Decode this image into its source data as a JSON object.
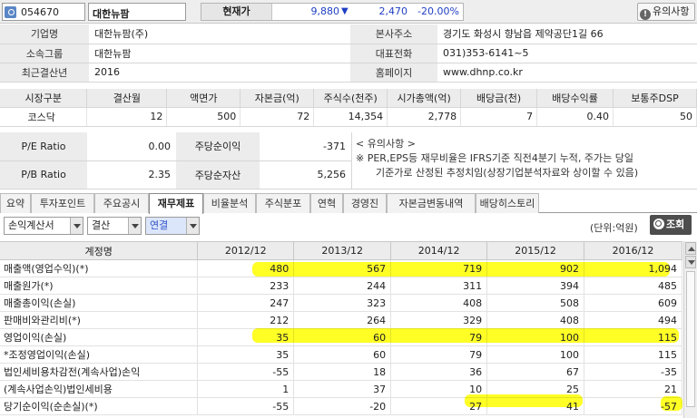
{
  "top": {
    "code": "054670",
    "name": "대한뉴팜",
    "price_label": "현재가",
    "price": "9,880",
    "change": "2,470",
    "change_pct": "-20.00%",
    "notice_label": "유의사항",
    "change_color": "#1f3fc4"
  },
  "info": {
    "rows": [
      {
        "h1": "기업명",
        "v1": "대한뉴팜(주)",
        "h2": "본사주소",
        "v2": "경기도 화성시 향남읍 제약공단1길 66"
      },
      {
        "h1": "소속그룹",
        "v1": "대한뉴팜",
        "h2": "대표전화",
        "v2": "031)353-6141~5"
      },
      {
        "h1": "최근결산년",
        "v1": "2016",
        "h2": "홈페이지",
        "v2": "www.dhnp.co.kr"
      }
    ]
  },
  "market": {
    "headers": [
      "시장구분",
      "결산월",
      "액면가",
      "자본금(억)",
      "주식수(천주)",
      "시가총액(억)",
      "배당금(천)",
      "배당수익률",
      "보통주DSP"
    ],
    "values": [
      "코스닥",
      "12",
      "500",
      "72",
      "14,354",
      "2,778",
      "7",
      "0.40",
      "50"
    ]
  },
  "ratios": {
    "per_label": "P/E Ratio",
    "per": "0.00",
    "eps_label": "주당순이익",
    "eps": "-371",
    "pbr_label": "P/B Ratio",
    "pbr": "2.35",
    "bps_label": "주당순자산",
    "bps": "5,256"
  },
  "note": {
    "title": "< 유의사항 >",
    "line1": "※ PER,EPS등 재무비율은 IFRS기준 직전4분기 누적, 주가는 당일",
    "line2": "기준가로 산정된 추정치임(상장기업분석자료와 상이할 수 있음)"
  },
  "tabs": [
    "요약",
    "투자포인트",
    "주요공시",
    "재무제표",
    "비율분석",
    "주식분포",
    "연혁",
    "경영진",
    "자본금변동내역",
    "배당히스토리"
  ],
  "active_tab": "재무제표",
  "controls": {
    "statement": "손익계산서",
    "period": "결산",
    "basis": "연결",
    "unit": "(단위:억원)",
    "view_label": "조회"
  },
  "financials": {
    "header_item": "계정명",
    "years": [
      "2012/12",
      "2013/12",
      "2014/12",
      "2015/12",
      "2016/12"
    ],
    "rows": [
      {
        "item": "매출액(영업수익)(*)",
        "values": [
          "480",
          "567",
          "719",
          "902",
          "1,094"
        ]
      },
      {
        "item": "매출원가(*)",
        "values": [
          "233",
          "244",
          "311",
          "394",
          "485"
        ]
      },
      {
        "item": "매출총이익(손실)",
        "values": [
          "247",
          "323",
          "408",
          "508",
          "609"
        ]
      },
      {
        "item": "판매비와관리비(*)",
        "values": [
          "212",
          "264",
          "329",
          "408",
          "494"
        ]
      },
      {
        "item": "영업이익(손실)",
        "values": [
          "35",
          "60",
          "79",
          "100",
          "115"
        ]
      },
      {
        "item": "*조정영업이익(손실)",
        "values": [
          "35",
          "60",
          "79",
          "100",
          "115"
        ]
      },
      {
        "item": "법인세비용차감전(계속사업)손익",
        "values": [
          "-55",
          "18",
          "36",
          "67",
          "-35"
        ]
      },
      {
        "item": "(계속사업손익)법인세비용",
        "values": [
          "1",
          "37",
          "10",
          "25",
          "21"
        ]
      },
      {
        "item": "당기순이익(순손실)(*)",
        "values": [
          "-55",
          "-20",
          "27",
          "41",
          "-57"
        ]
      }
    ]
  },
  "highlight_color": "#ffff00"
}
